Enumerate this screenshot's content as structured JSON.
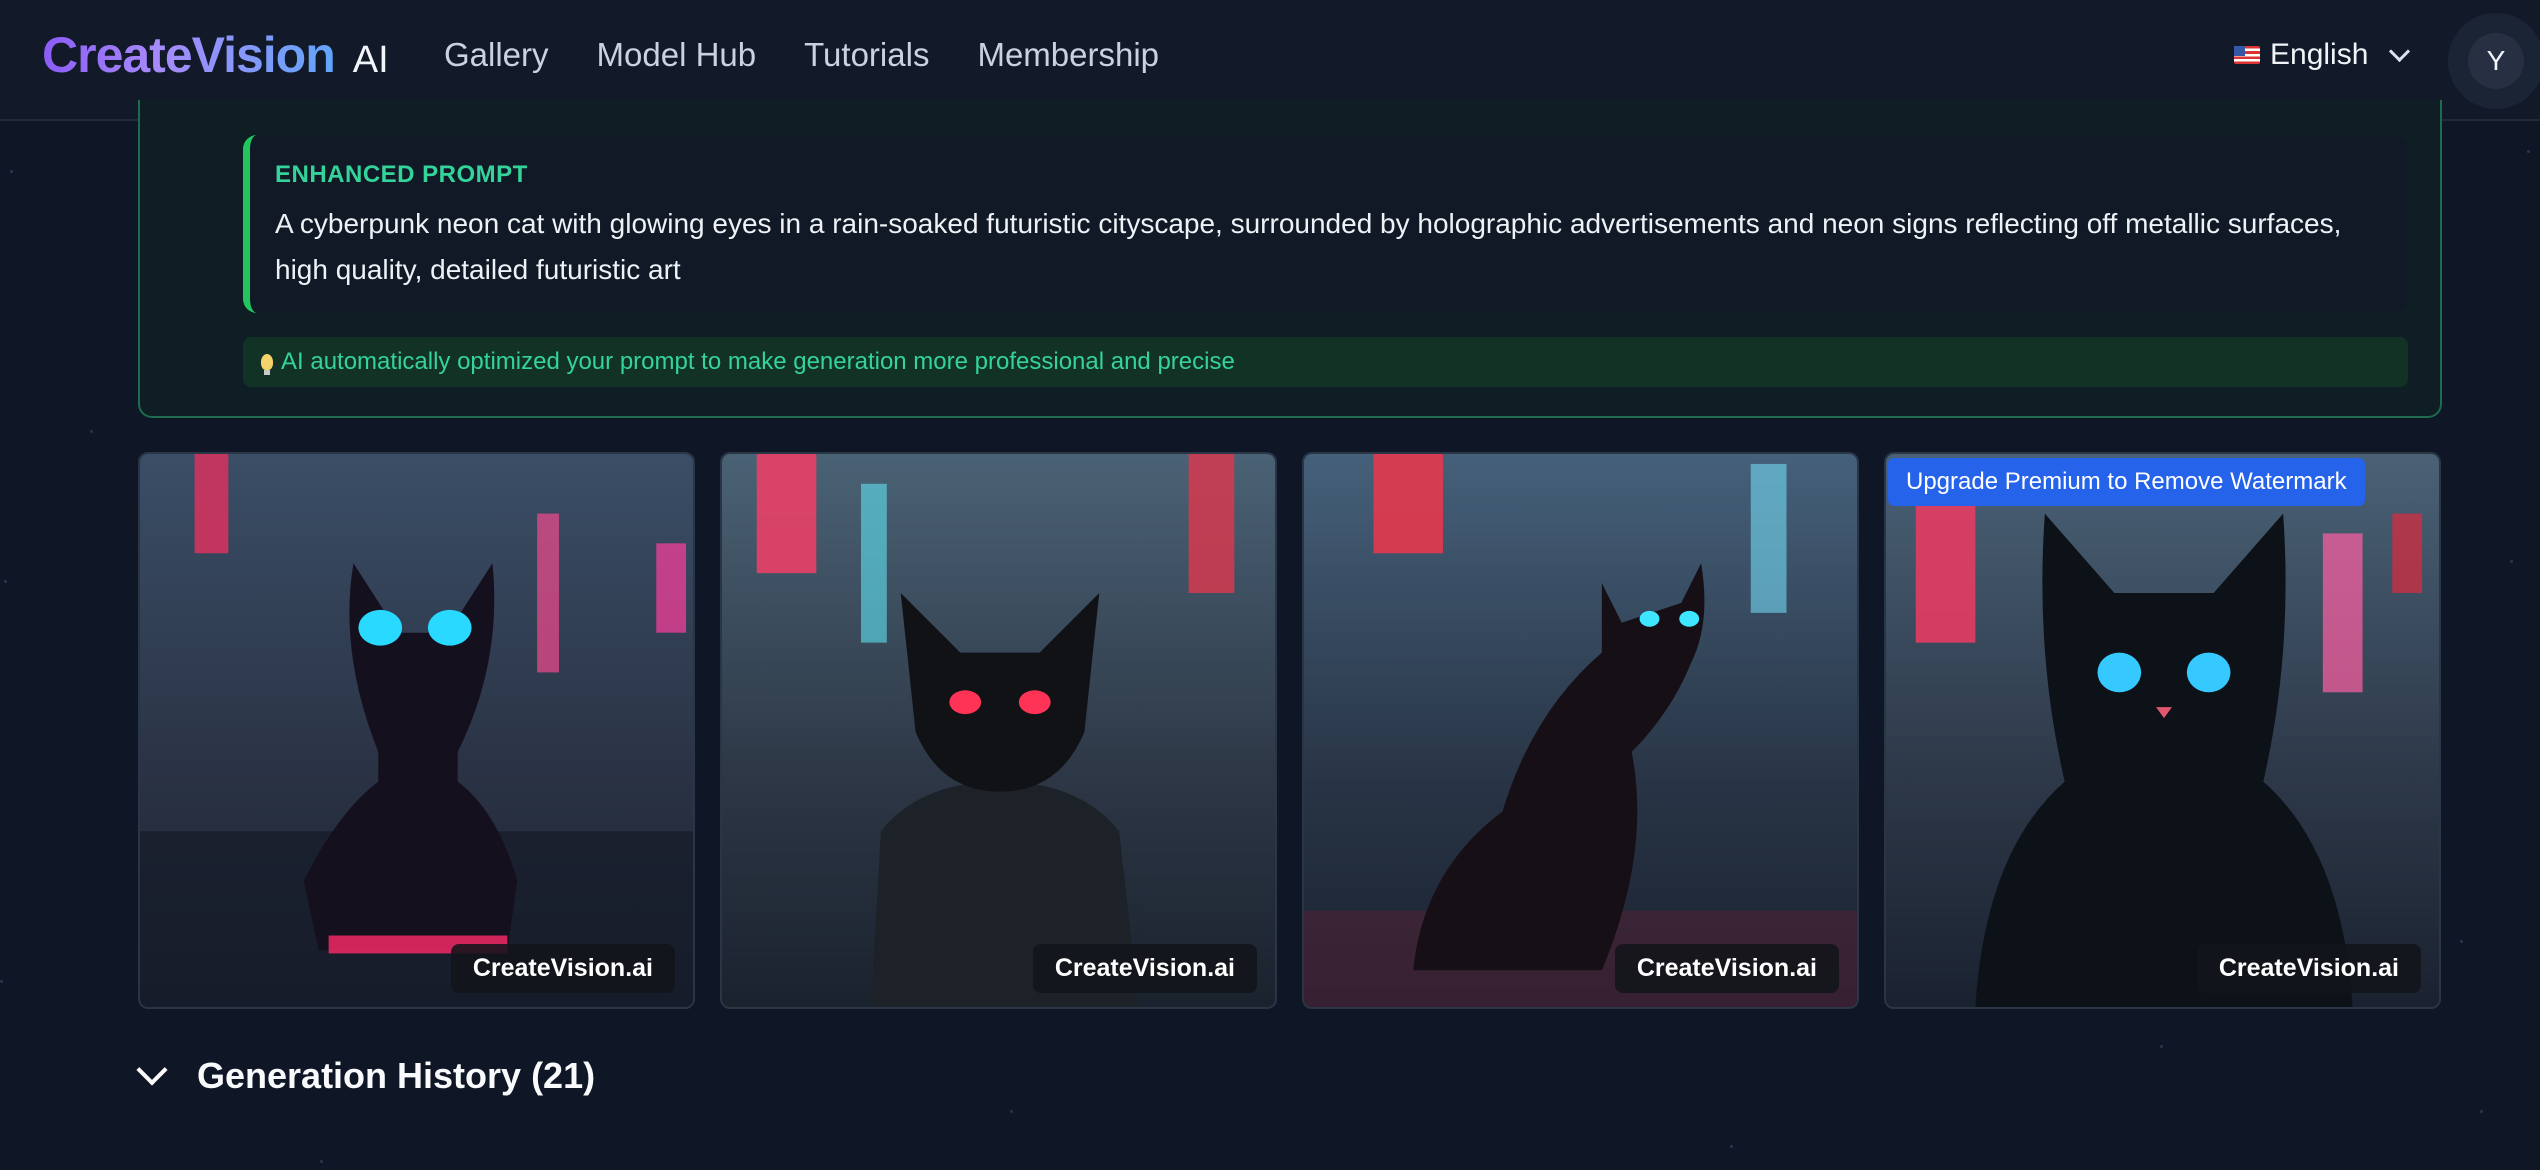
{
  "header": {
    "logo_main": "CreateVision",
    "logo_suffix": "AI",
    "nav": [
      "Gallery",
      "Model Hub",
      "Tutorials",
      "Membership"
    ],
    "language": "English",
    "avatar_initial": "Y"
  },
  "enhanced": {
    "title": "ENHANCED PROMPT",
    "text": "A cyberpunk neon cat with glowing eyes in a rain-soaked futuristic cityscape, surrounded by holographic advertisements and neon signs reflecting off metallic surfaces, high quality, detailed futuristic art",
    "tip": "AI automatically optimized your prompt to make generation more professional and precise"
  },
  "images": [
    {
      "watermark": "CreateVision.ai",
      "eye_color": "#29d9ff"
    },
    {
      "watermark": "CreateVision.ai",
      "eye_color": "#ff3355"
    },
    {
      "watermark": "CreateVision.ai",
      "eye_color": "#3ee6ff"
    },
    {
      "watermark": "CreateVision.ai",
      "eye_color": "#35c9ff",
      "badge": "Upgrade Premium to Remove Watermark"
    }
  ],
  "history": {
    "label": "Generation History (21)"
  }
}
